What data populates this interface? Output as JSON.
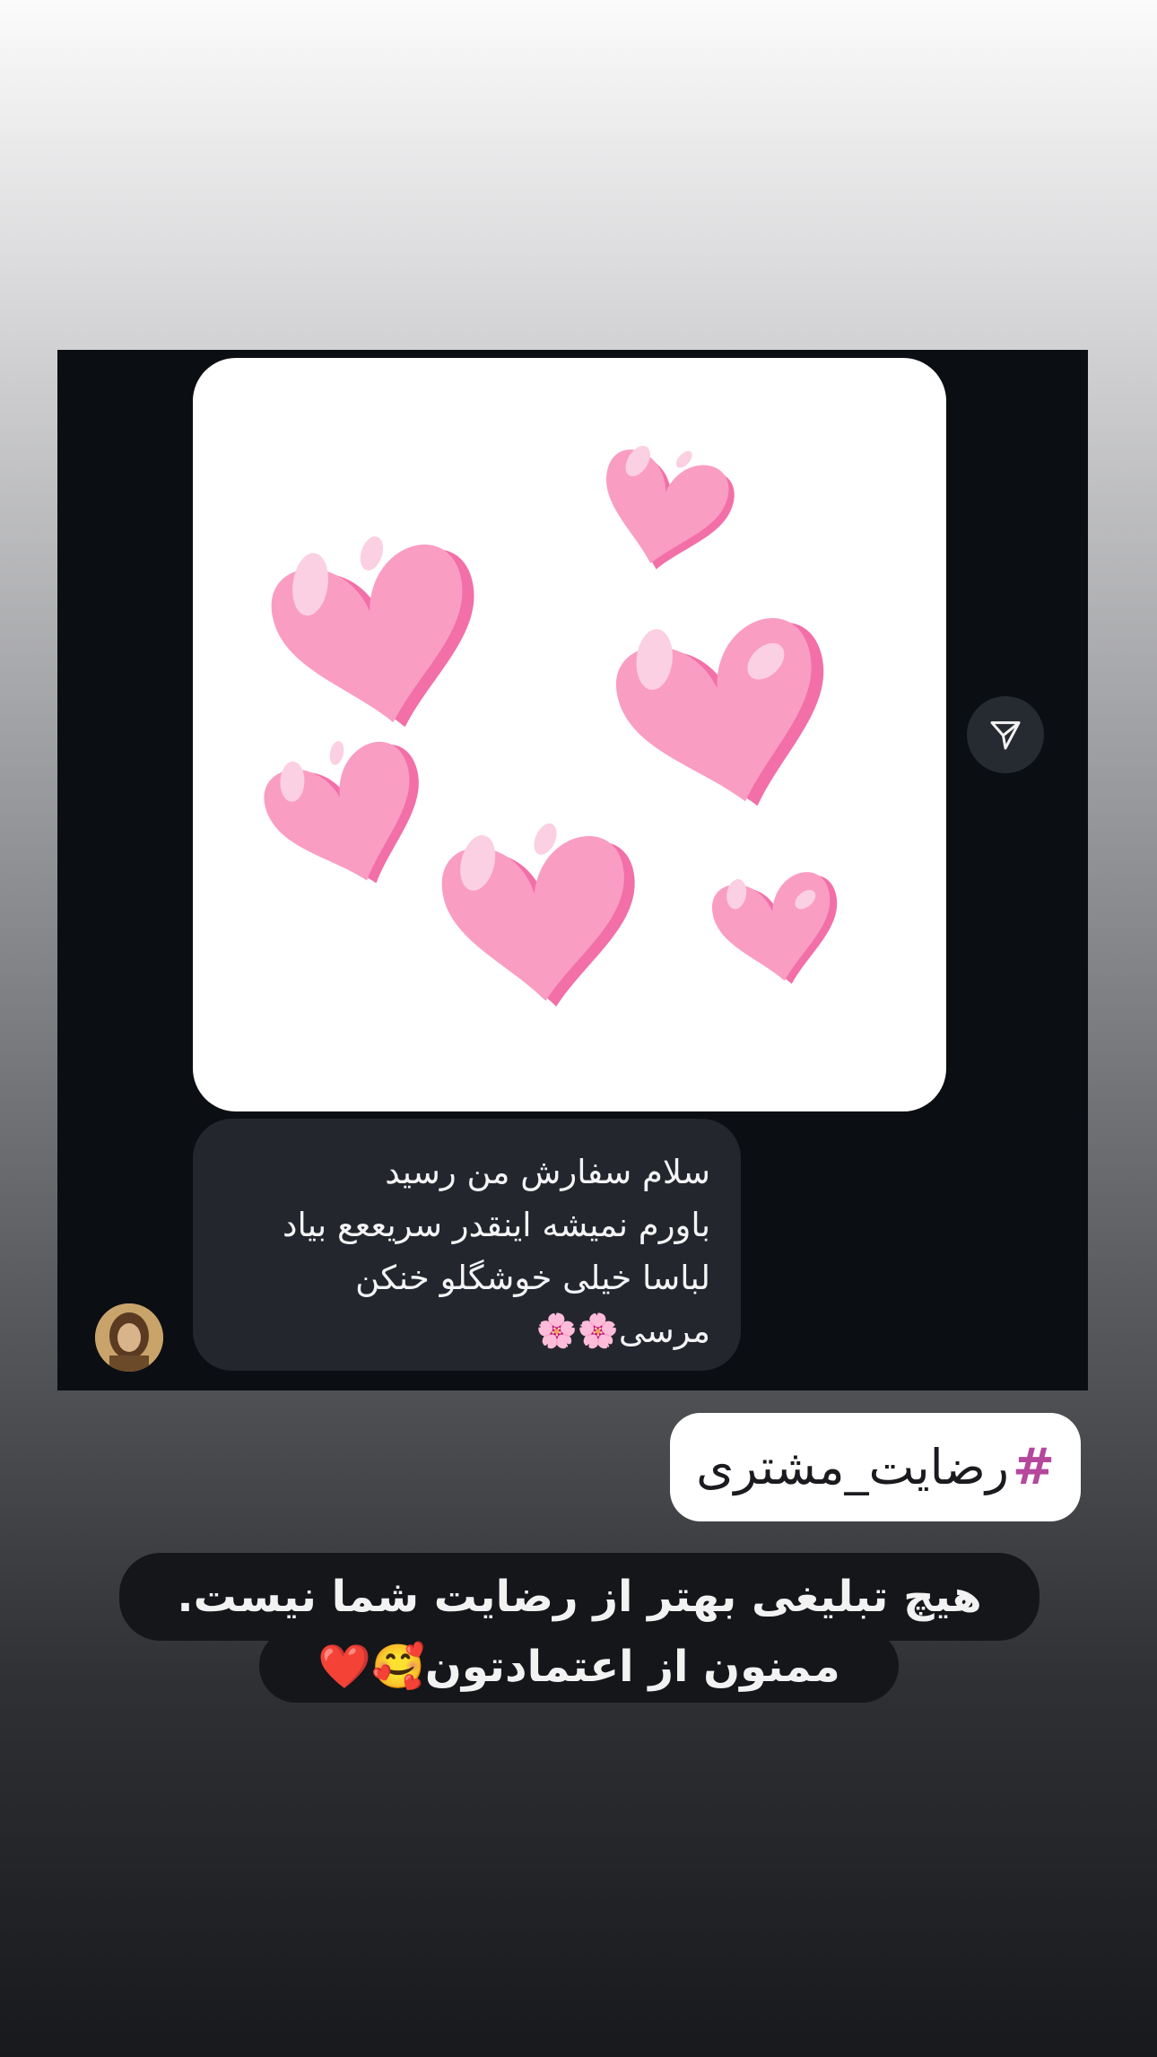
{
  "message": {
    "lines": [
      "سلام سفارش من رسید",
      "باورم نمیشه اینقدر سریععع بیاد",
      "لباسا خیلی خوشگلو خنکن",
      "مرسی🌸🌸"
    ]
  },
  "hashtag": {
    "hash": "#",
    "tag": "رضایت_مشتری"
  },
  "caption": {
    "line1": "هیچ تبلیغی بهتر از رضایت شما نیست.",
    "line2": "ممنون از اعتمادتون🥰❤️"
  },
  "icons": {
    "share": "send-icon",
    "avatar": "profile-avatar"
  },
  "colors": {
    "chat_background": "#0b0e13",
    "bubble": "#23262d",
    "heart_fill": "#fa9dc3",
    "heart_shadow": "#f26fa8",
    "hash_color": "#b5479c"
  }
}
